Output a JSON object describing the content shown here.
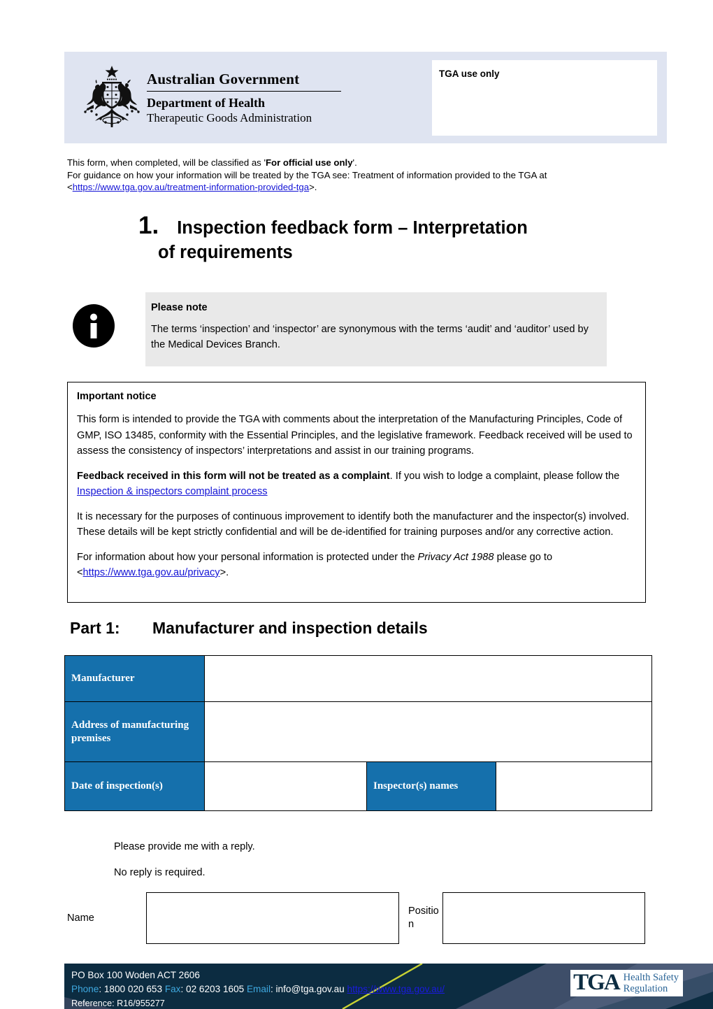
{
  "header": {
    "crest_alt": "australian-coat-of-arms",
    "gov_line1": "Australian Government",
    "gov_line2": "Department of Health",
    "gov_line3": "Therapeutic Goods Administration",
    "tga_use_only_label": "TGA use only"
  },
  "classification": {
    "line1_a": "This form, when completed, will be classified as '",
    "line1_bold": "For official use only",
    "line1_b": "'.",
    "line2": "For guidance on how your information will be treated by the TGA see: Treatment of information provided to the TGA at",
    "line3_prefix": "<",
    "line3_link": "https://www.tga.gov.au/treatment-information-provided-tga",
    "line3_suffix": ">."
  },
  "title": {
    "number": "1.",
    "line1": "Inspection feedback form – Interpretation",
    "line2": "of requirements"
  },
  "please_note": {
    "icon": "info-icon",
    "heading": "Please note",
    "body": "The terms ‘inspection’ and ‘inspector’ are synonymous with the terms ‘audit’ and ‘auditor’ used by the Medical Devices Branch."
  },
  "important_notice": {
    "heading": "Important notice",
    "para1": "This form is intended to provide the TGA with comments about the interpretation of the Manufacturing Principles, Code of GMP, ISO 13485, conformity with the Essential Principles, and the legislative framework. Feedback received will be used to assess the consistency of inspectors’ interpretations and assist in our training programs.",
    "para2_bold": "Feedback received in this form will not be treated as a complaint",
    "para2_mid": ". If you wish to lodge a complaint, please follow the ",
    "para2_link": "Inspection & inspectors complaint process",
    "para3": "It is necessary for the purposes of continuous improvement to identify both the manufacturer and the inspector(s) involved. These details will be kept strictly confidential and will be de-identified for training purposes and/or any corrective action.",
    "para4_a": "For information about how your personal information is protected under the ",
    "para4_italic": "Privacy Act 1988",
    "para4_b": " please go to <",
    "para4_link": "https://www.tga.gov.au/privacy",
    "para4_c": ">."
  },
  "part1": {
    "label": "Part 1:",
    "heading": "Manufacturer and inspection details",
    "rows": [
      {
        "key": "Manufacturer",
        "value": ""
      },
      {
        "key": "Address of manufacturing premises",
        "value": ""
      }
    ],
    "inspection_row": {
      "date_key": "Date of inspection(s)",
      "date_value": "",
      "inspector_key": "Inspector(s) names",
      "inspector_value": ""
    }
  },
  "reply_options": {
    "option1": "Please provide me with a reply.",
    "option2": "No reply is required."
  },
  "signature": {
    "name_label": "Name",
    "name_value": "",
    "position_label": "Positio\nn",
    "position_label_line1": "Positio",
    "position_label_line2": "n",
    "position_value": ""
  },
  "footer": {
    "address": "PO Box 100  Woden ACT 2606",
    "phone_label": "Phone",
    "phone_value": ": 1800 020 653  ",
    "fax_label": "Fax",
    "fax_value": ": 02 6203 1605  ",
    "email_label": "Email",
    "email_value": ": info@tga.gov.au  ",
    "website": "https://www.tga.gov.au/",
    "reference": "Reference: R16/955277",
    "logo_mark": "TGA",
    "logo_sub_line1": "Health Safety",
    "logo_sub_line2": "Regulation"
  },
  "colors": {
    "header_band": "#dfe4f1",
    "table_key_blue": "#1570ac",
    "footer_navy": "#0c2c41",
    "link_blue": "#1414d6",
    "note_grey": "#e9e9e9"
  }
}
